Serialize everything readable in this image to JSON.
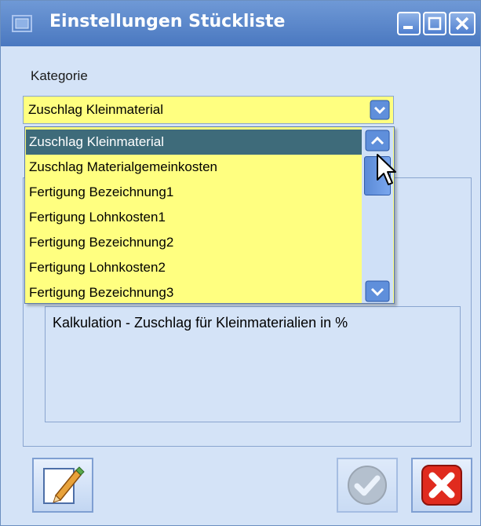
{
  "window": {
    "title": "Einstellungen Stückliste"
  },
  "form": {
    "kategorie_label": "Kategorie",
    "selected": "Zuschlag Kleinmaterial",
    "description": "Kalkulation - Zuschlag für Kleinmaterialien in %"
  },
  "dropdown": {
    "items": [
      "Zuschlag Kleinmaterial",
      "Zuschlag Materialgemeinkosten",
      "Fertigung Bezeichnung1",
      "Fertigung Lohnkosten1",
      "Fertigung Bezeichnung2",
      "Fertigung Lohnkosten2",
      "Fertigung Bezeichnung3"
    ],
    "selected_index": 0
  },
  "colors": {
    "accent": "#4a78c0",
    "field_background": "#ffff80",
    "selection": "#3e6b7a",
    "window_background": "#d4e3f7"
  },
  "icons": [
    "app-icon",
    "minimize-icon",
    "maximize-icon",
    "close-icon",
    "chevron-down-icon",
    "chevron-up-icon",
    "mouse-cursor-icon",
    "edit-pencil-icon",
    "checkmark-icon",
    "cancel-x-icon"
  ]
}
